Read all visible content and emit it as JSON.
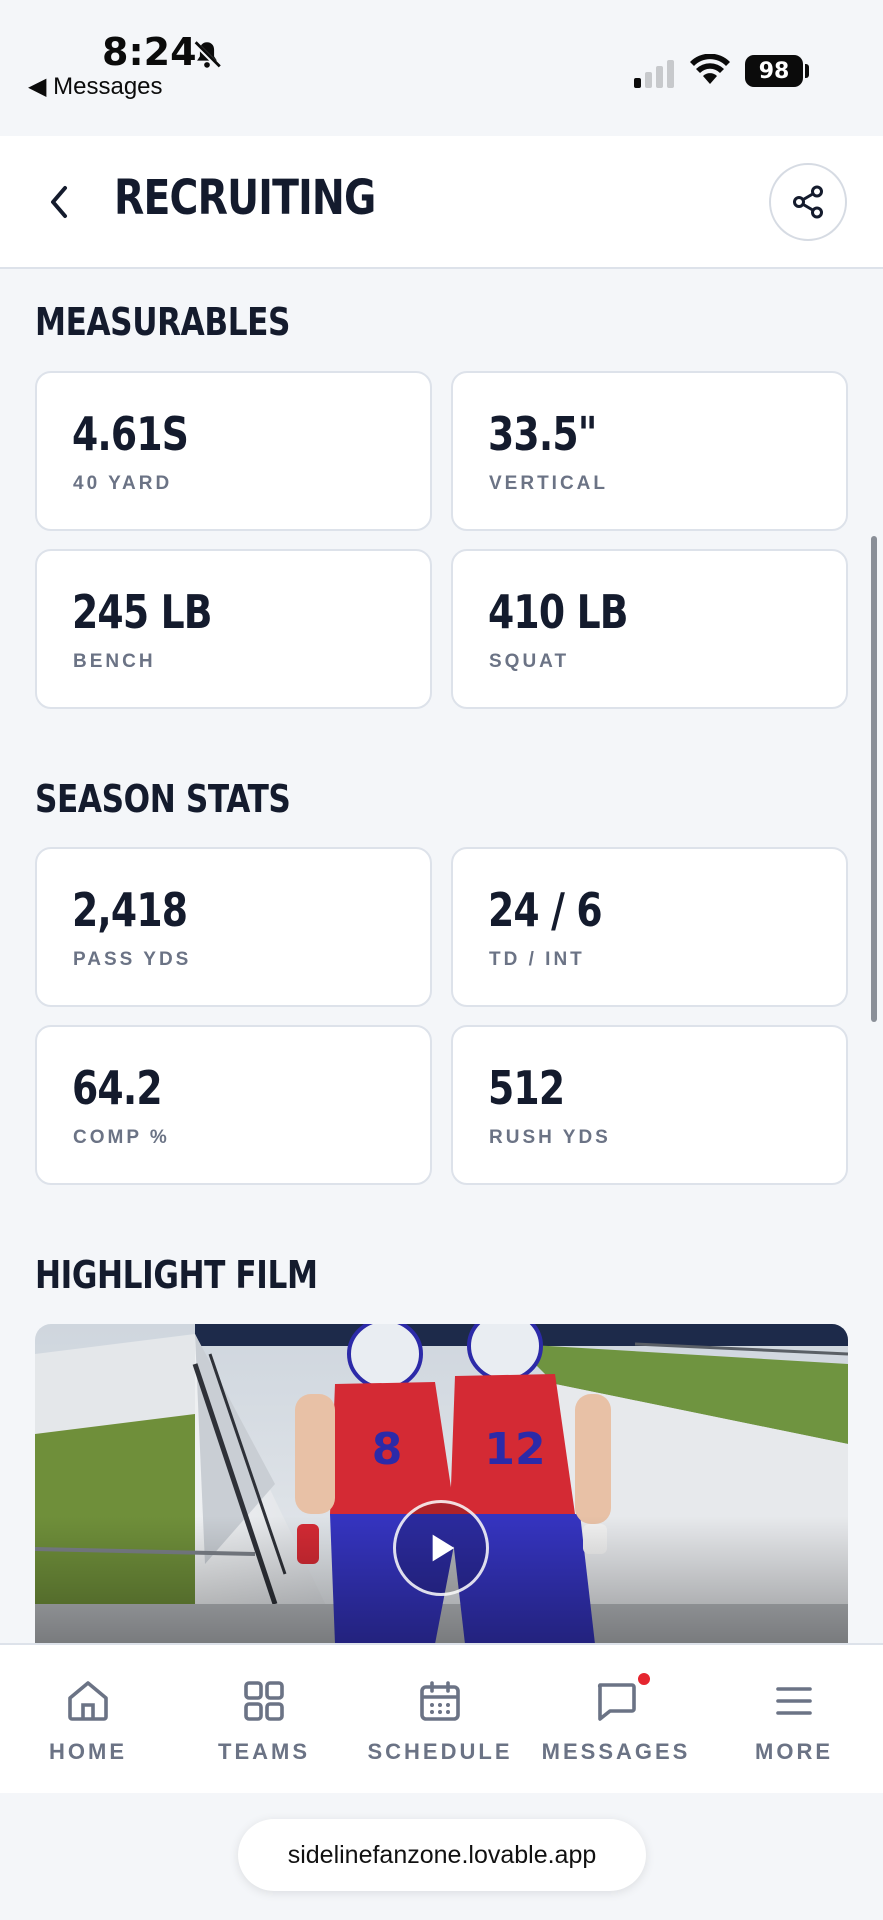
{
  "status_bar": {
    "time": "8:24",
    "back_app": "◀ Messages",
    "battery": "98"
  },
  "header": {
    "title": "RECRUITING"
  },
  "measurables": {
    "title": "MEASURABLES",
    "cards": [
      {
        "value": "4.61S",
        "label": "40 YARD"
      },
      {
        "value": "33.5\"",
        "label": "VERTICAL"
      },
      {
        "value": "245 LB",
        "label": "BENCH"
      },
      {
        "value": "410 LB",
        "label": "SQUAT"
      }
    ]
  },
  "season_stats": {
    "title": "SEASON STATS",
    "cards": [
      {
        "value": "2,418",
        "label": "PASS YDS"
      },
      {
        "value": "24 / 6",
        "label": "TD / INT"
      },
      {
        "value": "64.2",
        "label": "COMP %"
      },
      {
        "value": "512",
        "label": "RUSH YDS"
      }
    ]
  },
  "highlight_film": {
    "title": "HIGHLIGHT FILM",
    "jersey_numbers": [
      "8",
      "12"
    ]
  },
  "bottom_nav": {
    "items": [
      {
        "label": "HOME",
        "icon": "home-icon"
      },
      {
        "label": "TEAMS",
        "icon": "grid-icon"
      },
      {
        "label": "SCHEDULE",
        "icon": "calendar-icon"
      },
      {
        "label": "MESSAGES",
        "icon": "chat-icon",
        "badge": true
      },
      {
        "label": "MORE",
        "icon": "menu-icon"
      }
    ]
  },
  "browser": {
    "url": "sidelinefanzone.lovable.app"
  },
  "colors": {
    "background": "#f4f6f9",
    "text": "#141b2d",
    "muted": "#6b7385",
    "badge": "#e5252f",
    "jersey_red": "#d42a34",
    "jersey_blue": "#2c2aa8"
  }
}
